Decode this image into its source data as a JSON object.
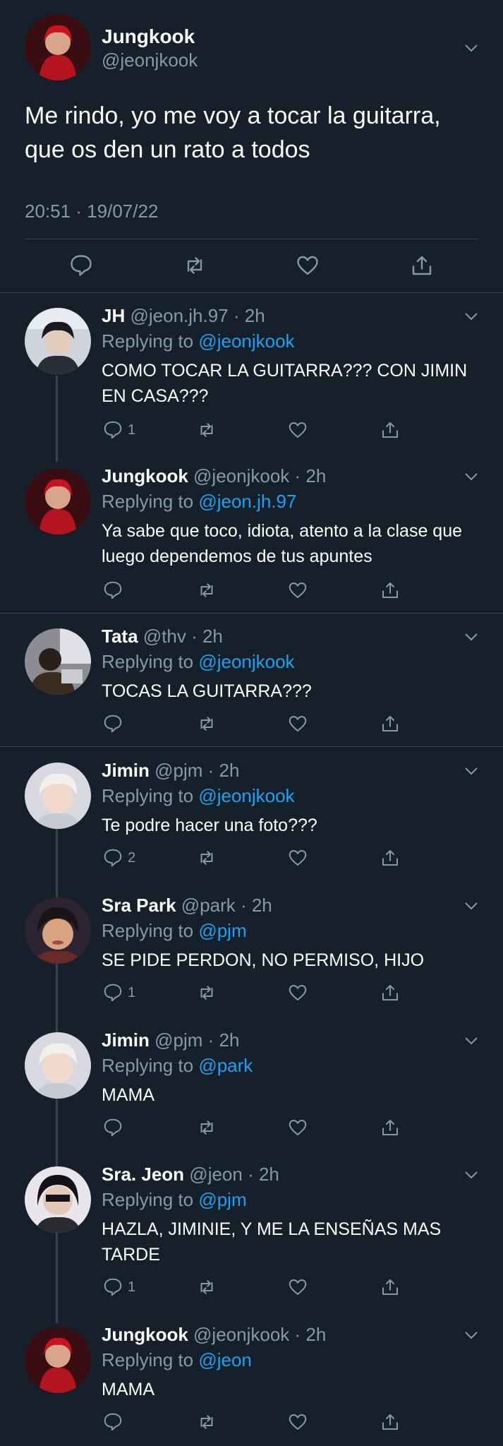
{
  "main": {
    "name": "Jungkook",
    "handle": "@jeonjkook",
    "text": "Me rindo, yo me voy a tocar la guitarra, que os den un rato a todos",
    "timestamp": "20:51 · 19/07/22"
  },
  "replying_prefix": "Replying to ",
  "replies": [
    {
      "name": "JH",
      "meta": "@jeon.jh.97 · 2h",
      "to": "@jeonjkook",
      "text": "COMO TOCAR LA GUITARRA??? CON JIMIN EN CASA???",
      "reply_count": "1"
    },
    {
      "name": "Jungkook",
      "meta": "@jeonjkook · 2h",
      "to": "@jeon.jh.97",
      "text": "Ya sabe que toco, idiota, atento a la clase que luego dependemos de tus apuntes",
      "reply_count": ""
    },
    {
      "name": "Tata",
      "meta": "@thv · 2h",
      "to": "@jeonjkook",
      "text": "TOCAS LA GUITARRA???",
      "reply_count": ""
    },
    {
      "name": "Jimin",
      "meta": "@pjm · 2h",
      "to": "@jeonjkook",
      "text": "Te podre hacer una foto???",
      "reply_count": "2"
    },
    {
      "name": "Sra Park",
      "meta": "@park · 2h",
      "to": "@pjm",
      "text": "SE PIDE PERDON, NO PERMISO, HIJO",
      "reply_count": "1"
    },
    {
      "name": "Jimin",
      "meta": "@pjm · 2h",
      "to": "@park",
      "text": "MAMA",
      "reply_count": ""
    },
    {
      "name": "Sra. Jeon",
      "meta": "@jeon · 2h",
      "to": "@pjm",
      "text": "HAZLA, JIMINIE, Y ME LA ENSEÑAS MAS TARDE",
      "reply_count": "1"
    },
    {
      "name": "Jungkook",
      "meta": "@jeonjkook · 2h",
      "to": "@jeon",
      "text": "MAMA",
      "reply_count": ""
    }
  ],
  "colors": {
    "background": "#15202b",
    "secondary_text": "#8899a6",
    "link": "#1da1f2",
    "divider": "#38444d"
  },
  "icons": [
    "chevron-down-icon",
    "reply-icon",
    "retweet-icon",
    "like-icon",
    "share-icon"
  ]
}
